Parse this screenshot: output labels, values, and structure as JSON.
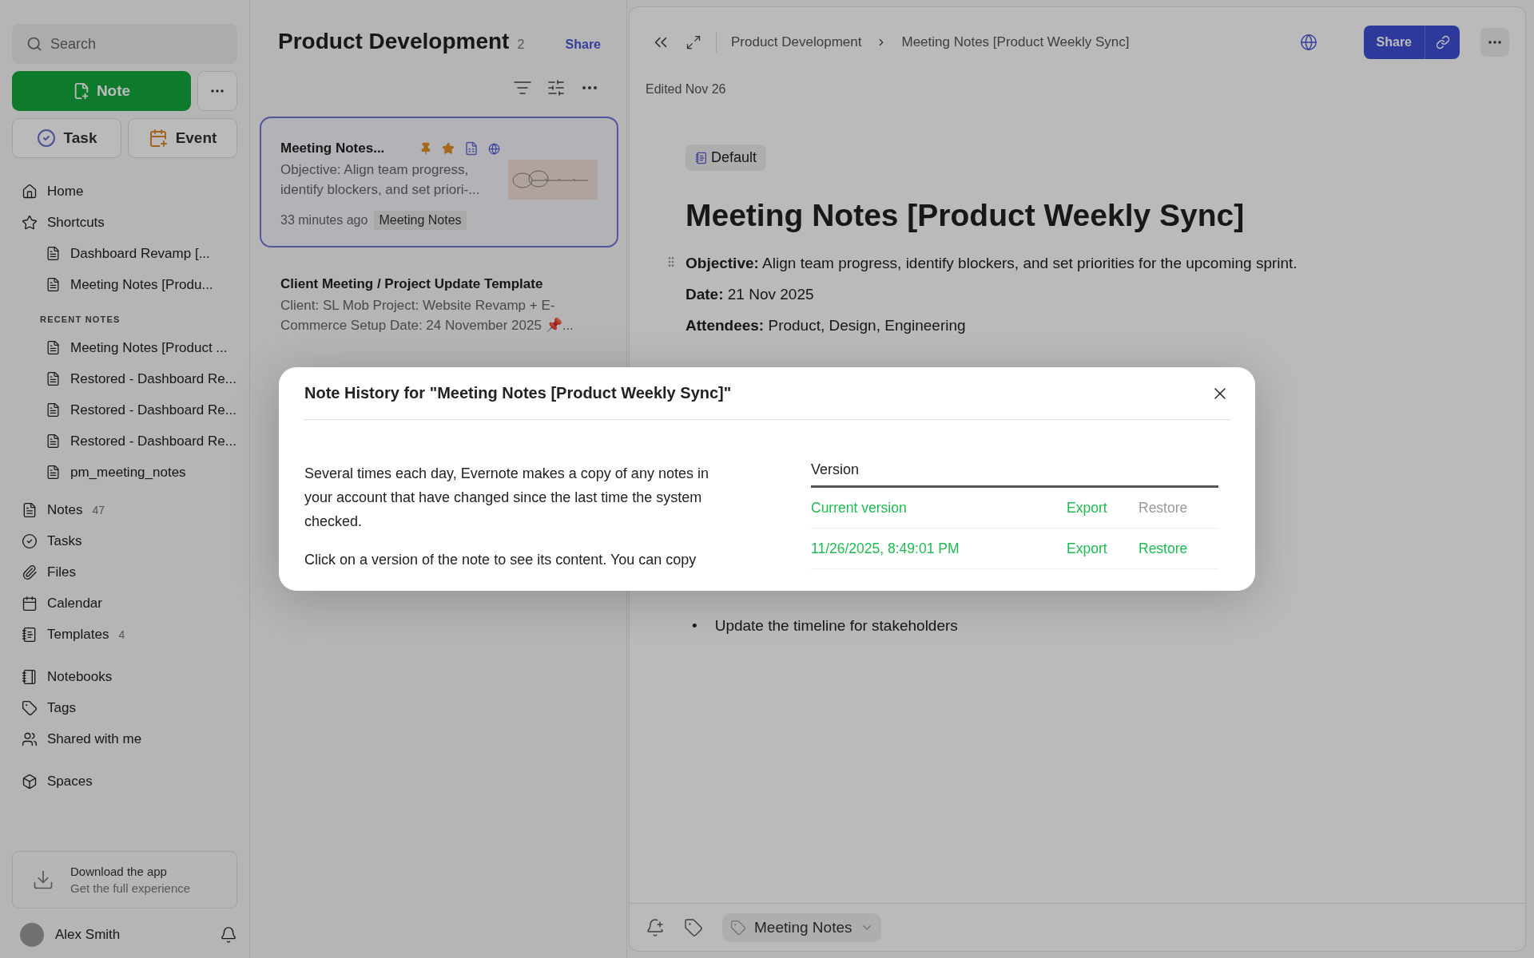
{
  "sidebar": {
    "search": {
      "placeholder": "Search"
    },
    "new_note": "Note",
    "task": "Task",
    "event": "Event",
    "nav": [
      {
        "label": "Home"
      },
      {
        "label": "Shortcuts"
      }
    ],
    "shortcuts": [
      "Dashboard Revamp [...",
      "Meeting Notes [Produ..."
    ],
    "recent_heading": "RECENT NOTES",
    "recent": [
      "Meeting Notes [Product ...",
      "Restored - Dashboard Re...",
      "Restored - Dashboard Re...",
      "Restored - Dashboard Re...",
      "pm_meeting_notes"
    ],
    "sections": [
      [
        {
          "label": "Notes",
          "count": "47"
        },
        {
          "label": "Tasks"
        },
        {
          "label": "Files"
        },
        {
          "label": "Calendar"
        },
        {
          "label": "Templates",
          "count": "4"
        }
      ],
      [
        {
          "label": "Notebooks"
        },
        {
          "label": "Tags"
        },
        {
          "label": "Shared with me"
        }
      ],
      [
        {
          "label": "Spaces"
        }
      ]
    ],
    "download": {
      "title": "Download the app",
      "subtitle": "Get the full experience"
    },
    "user": {
      "name": "Alex Smith"
    }
  },
  "note_list": {
    "title": "Product Development",
    "count": "2",
    "share": "Share",
    "notes": [
      {
        "title": "Meeting Notes...",
        "snippet": "Objective: Align team progress, identify blockers, and set priori-...",
        "time": "33 minutes ago",
        "tag": "Meeting Notes",
        "selected": true,
        "pinned": true,
        "starred": true
      },
      {
        "title": "Client Meeting / Project Update Template",
        "snippet": "Client: SL Mob Project: Website Revamp + E-Commerce Setup Date: 24 November 2025 📌...",
        "selected": false,
        "pinned": false,
        "starred": false
      }
    ]
  },
  "editor": {
    "breadcrumb": [
      "Product Development",
      "Meeting Notes [Product Weekly Sync]"
    ],
    "share": "Share",
    "edited": "Edited Nov 26",
    "notebook": "Default",
    "title": "Meeting Notes [Product Weekly Sync]",
    "fields": [
      "**Objective:** Align team progress, identify blockers, and set priorities for the upcoming sprint.",
      "**Date:** 21 Nov 2025",
      "**Attendees:** Product, Design, Engineering"
    ],
    "bullets": [
      {
        "marker": "•",
        "text": "Update the timeline for stakeholders"
      }
    ],
    "footer_tag": "Meeting Notes"
  },
  "modal": {
    "title": "Note History for \"Meeting Notes [Product Weekly Sync]\"",
    "paragraphs": [
      "Several times each day, Evernote makes a copy of any notes in your account that have changed since the last time the system checked.",
      "Click on a version of the note to see its content. You can copy"
    ],
    "column": "Version",
    "rows": [
      {
        "version": "Current version",
        "export": "Export",
        "restore": "Restore",
        "restore_disabled": true
      },
      {
        "version": "11/26/2025, 8:49:01 PM",
        "export": "Export",
        "restore": "Restore",
        "restore_disabled": false
      }
    ]
  }
}
